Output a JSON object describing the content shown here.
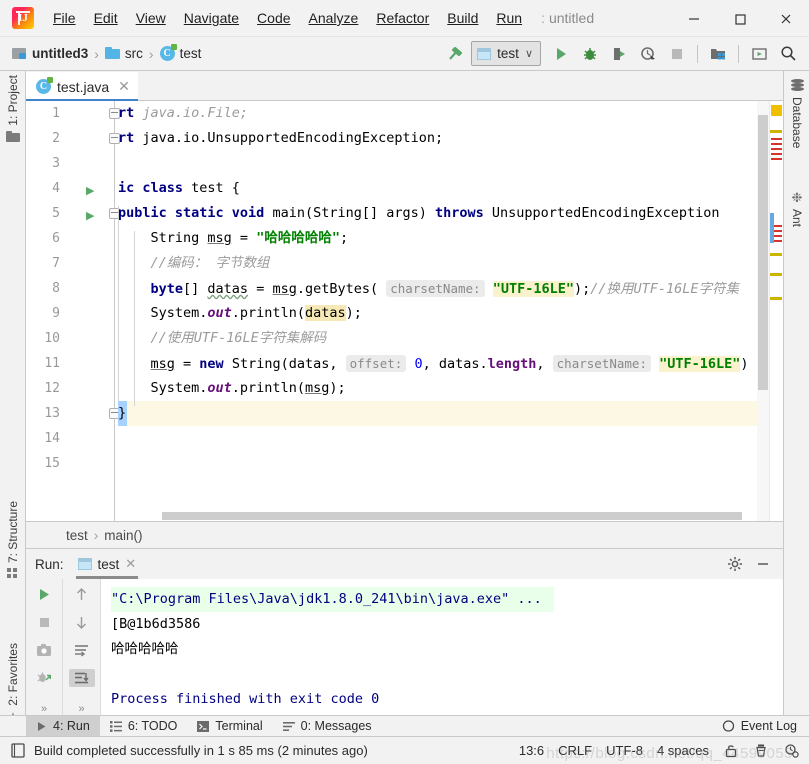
{
  "titlebar": {
    "menus": [
      "File",
      "Edit",
      "View",
      "Navigate",
      "Code",
      "Analyze",
      "Refactor",
      "Build",
      "Run"
    ],
    "project_title": "untitled",
    "minimize": "—",
    "maximize": "□",
    "close": "✕"
  },
  "navbar": {
    "crumbs": [
      {
        "label": "untitled3",
        "icon": "module-icon"
      },
      {
        "label": "src",
        "icon": "folder-icon"
      },
      {
        "label": "test",
        "icon": "java-class-icon"
      }
    ],
    "separator": "›",
    "run_config": "test",
    "dropdown_arrow": "∨",
    "icons": [
      "build-hammer-icon",
      "run-icon",
      "debug-icon",
      "run-coverage-icon",
      "profile-icon",
      "stop-icon",
      "project-structure-icon",
      "update-icon",
      "search-everywhere-icon"
    ]
  },
  "left_strip": {
    "project": "1: Project",
    "structure": "7: Structure",
    "favorites": "2: Favorites"
  },
  "right_strip": {
    "database": "Database",
    "ant": "Ant"
  },
  "editor": {
    "tab_name": "test.java",
    "tab_close": "✕",
    "line_numbers": [
      "1",
      "2",
      "3",
      "4",
      "5",
      "6",
      "7",
      "8",
      "9",
      "10",
      "11",
      "12",
      "13",
      "14",
      "15"
    ],
    "code_lines": [
      {
        "n": 1,
        "text": "rt java.io.File;"
      },
      {
        "n": 2,
        "text": "rt java.io.UnsupportedEncodingException;"
      },
      {
        "n": 3,
        "text": ""
      },
      {
        "n": 4,
        "text": "ic class test {"
      },
      {
        "n": 5,
        "text": "public static void main(String[] args) throws UnsupportedEncodingException"
      },
      {
        "n": 6,
        "text": "    String msg = \"哈哈哈哈哈\";"
      },
      {
        "n": 7,
        "text": "    //编码： 字节数组"
      },
      {
        "n": 8,
        "text": "    byte[] datas = msg.getBytes( charsetName: \"UTF-16LE\");//换用UTF-16LE字符集"
      },
      {
        "n": 9,
        "text": "    System.out.println(datas);"
      },
      {
        "n": 10,
        "text": "    //使用UTF-16LE字符集解码"
      },
      {
        "n": 11,
        "text": "    msg = new String(datas,  offset: 0, datas.length,  charsetName: \"UTF-16LE\")"
      },
      {
        "n": 12,
        "text": "    System.out.println(msg);"
      },
      {
        "n": 13,
        "text": "}"
      },
      {
        "n": 14,
        "text": ""
      },
      {
        "n": 15,
        "text": ""
      }
    ],
    "tokens": {
      "import_frag": "rt",
      "pkg_file": " java.io.File;",
      "pkg_exc": " java.io.UnsupportedEncodingException;",
      "class_frag": "ic ",
      "kw_class": "class",
      "class_name": " test {",
      "kw_public": "public",
      "kw_static": "static",
      "kw_void": "void",
      "main_sig": "main(String[] args) ",
      "kw_throws": "throws",
      "exc_name": " UnsupportedEncodingException",
      "kw_String": "String",
      "var_msg": "msg",
      "eq": " = ",
      "str_haha": "\"哈哈哈哈哈\"",
      "semi": ";",
      "cmt_encode": "//编码： 字节数组",
      "kw_byte": "byte",
      "brackets": "[] ",
      "var_datas": "datas",
      "call_getbytes": ".getBytes( ",
      "hint_charset": "charsetName:",
      "str_utf16le": "\"UTF-16LE\"",
      "close_paren_semi": ");",
      "cmt_change": "//换用UTF-16LE字符集",
      "sys": "System.",
      "out": "out",
      "println_datas": ".println(",
      "println_close": ");",
      "cmt_decode": "//使用UTF-16LE字符集解码",
      "kw_new": "new",
      "new_string": " String(datas, ",
      "hint_offset": "offset:",
      "zero": "0",
      "comma_len": ", datas.",
      "length": "length",
      "comma2": ", ",
      "close_paren": ")",
      "var_msg2": "msg",
      "close_brace": "}"
    },
    "breadcrumb": {
      "class": "test",
      "method": "main()",
      "sep": "›"
    }
  },
  "run_panel": {
    "label": "Run:",
    "tab_name": "test",
    "tab_close": "✕",
    "console_lines": [
      {
        "text": "\"C:\\Program Files\\Java\\jdk1.8.0_241\\bin\\java.exe\" ...",
        "style": "cmd"
      },
      {
        "text": "[B@1b6d3586",
        "style": "plain"
      },
      {
        "text": "哈哈哈哈哈",
        "style": "plain"
      },
      {
        "text": "",
        "style": "plain"
      },
      {
        "text": "Process finished with exit code 0",
        "style": "info"
      }
    ],
    "tool_icons": [
      "rerun-icon",
      "stop-icon",
      "screenshot-icon",
      "dump-threads-icon",
      "expand-more-icon"
    ],
    "tool_icons2": [
      "scroll-up-icon",
      "scroll-down-icon",
      "soft-wrap-icon",
      "scroll-to-end-icon",
      "expand-more-icon"
    ],
    "settings_icon": "gear-icon",
    "hide_icon": "minimize-icon",
    "chevron": "»"
  },
  "bottom_bar": {
    "items": [
      {
        "label": "4: Run",
        "mnemonic": "4",
        "icon": "run-icon",
        "active": true
      },
      {
        "label": "6: TODO",
        "mnemonic": "6",
        "icon": "todo-icon",
        "active": false
      },
      {
        "label": "Terminal",
        "mnemonic": "",
        "icon": "terminal-icon",
        "active": false
      },
      {
        "label": "0: Messages",
        "mnemonic": "0",
        "icon": "messages-icon",
        "active": false
      }
    ],
    "event_log": "Event Log"
  },
  "status_bar": {
    "message": "Build completed successfully in 1 s 85 ms (2 minutes ago)",
    "caret": "13:6",
    "line_sep": "CRLF",
    "encoding": "UTF-8",
    "indent": "4 spaces",
    "icons": [
      "lock-icon",
      "inspection-icon",
      "background-tasks-icon"
    ],
    "watermark": "https://blog.csdn.net/qq_44599055"
  },
  "colors": {
    "accent_blue": "#4083c9",
    "green_run": "#59a869",
    "string_green": "#008000",
    "keyword_navy": "#000080",
    "console_blue": "#000080",
    "highlight_yellow": "#faf2cc",
    "current_line": "#fdf8e3",
    "selection_blue": "#a6d2ff",
    "marker_yellow": "#cdb400"
  }
}
